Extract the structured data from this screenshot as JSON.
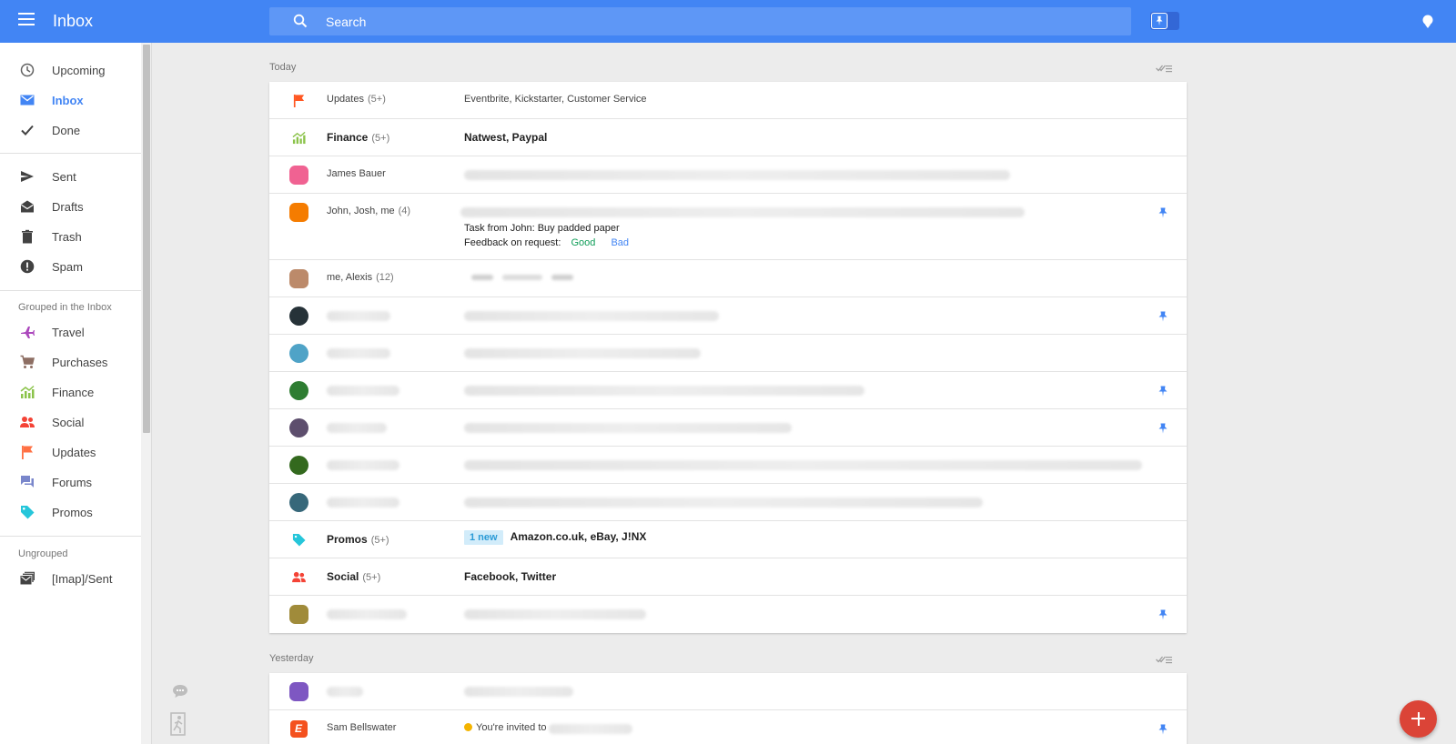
{
  "header": {
    "title": "Inbox",
    "search_placeholder": "Search"
  },
  "sidebar": {
    "primary": [
      {
        "label": "Upcoming",
        "icon": "clock-icon"
      },
      {
        "label": "Inbox",
        "icon": "envelope-icon",
        "active": true
      },
      {
        "label": "Done",
        "icon": "checkmark-icon"
      }
    ],
    "folders": [
      {
        "label": "Sent",
        "icon": "send-icon"
      },
      {
        "label": "Drafts",
        "icon": "drafts-icon"
      },
      {
        "label": "Trash",
        "icon": "trash-icon"
      },
      {
        "label": "Spam",
        "icon": "spam-icon"
      }
    ],
    "grouped_heading": "Grouped in the Inbox",
    "grouped": [
      {
        "label": "Travel",
        "icon": "plane-icon",
        "color": "#ab47bc"
      },
      {
        "label": "Purchases",
        "icon": "cart-icon",
        "color": "#8d6e63"
      },
      {
        "label": "Finance",
        "icon": "chart-icon",
        "color": "#8bc34a"
      },
      {
        "label": "Social",
        "icon": "people-icon",
        "color": "#f44336"
      },
      {
        "label": "Updates",
        "icon": "flag-icon",
        "color": "#ff7043"
      },
      {
        "label": "Forums",
        "icon": "forum-icon",
        "color": "#7986cb"
      },
      {
        "label": "Promos",
        "icon": "tag-icon",
        "color": "#26c6da"
      }
    ],
    "ungrouped_heading": "Ungrouped",
    "ungrouped": [
      {
        "label": "[Imap]/Sent",
        "icon": "mail-stack-icon"
      }
    ]
  },
  "sections": {
    "today": "Today",
    "yesterday": "Yesterday"
  },
  "today_rows": {
    "updates": {
      "sender": "Updates",
      "count": "(5+)",
      "subject": "Eventbrite, Kickstarter, Customer Service",
      "color": "#ff5722"
    },
    "finance": {
      "sender": "Finance",
      "count": "(5+)",
      "subject": "Natwest, Paypal",
      "color": "#8bc34a"
    },
    "james": {
      "sender": "James Bauer"
    },
    "john": {
      "sender": "John, Josh, me",
      "count": "(4)",
      "task": "Task from John: Buy padded paper",
      "feedback_label": "Feedback on request:",
      "good": "Good",
      "bad": "Bad"
    },
    "alexis": {
      "sender": "me, Alexis",
      "count": "(12)"
    },
    "promos": {
      "sender": "Promos",
      "count": "(5+)",
      "badge": "1 new",
      "subject": "Amazon.co.uk, eBay, J!NX",
      "color": "#26c6da"
    },
    "social": {
      "sender": "Social",
      "count": "(5+)",
      "subject": "Facebook, Twitter",
      "color": "#f44336"
    }
  },
  "yesterday_rows": {
    "sam": {
      "sender": "Sam Bellswater",
      "subject": "You're invited to",
      "color": "#f4511e"
    }
  },
  "colors": {
    "brand": "#4285f4",
    "fab": "#db4437"
  }
}
